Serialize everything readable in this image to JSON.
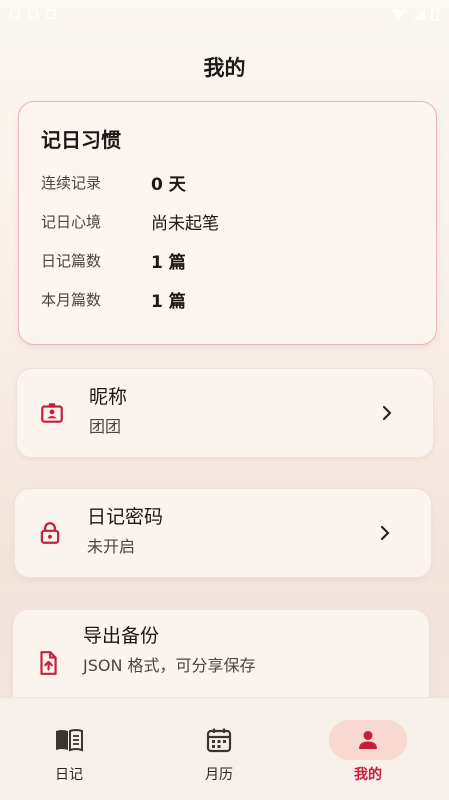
{
  "page": {
    "title": "我的"
  },
  "habit": {
    "title": "记日习惯",
    "rows": [
      {
        "label": "连续记录",
        "value": "0 天"
      },
      {
        "label": "记日心境",
        "value": "尚未起笔"
      },
      {
        "label": "日记篇数",
        "value": "1 篇"
      },
      {
        "label": "本月篇数",
        "value": "1 篇"
      }
    ]
  },
  "settings": [
    {
      "title": "昵称",
      "subtitle": "团团",
      "icon": "id-badge-icon"
    },
    {
      "title": "日记密码",
      "subtitle": "未开启",
      "icon": "lock-icon"
    },
    {
      "title": "导出备份",
      "subtitle": "JSON 格式，可分享保存",
      "icon": "file-upload-icon"
    }
  ],
  "nav": [
    {
      "label": "日记",
      "icon": "book-icon"
    },
    {
      "label": "月历",
      "icon": "calendar-icon"
    },
    {
      "label": "我的",
      "icon": "person-icon",
      "active": true
    }
  ],
  "colors": {
    "accent": "#c51f3b",
    "nav_active_bg": "#f8d8cf",
    "card_border": "#e7b8bf"
  }
}
